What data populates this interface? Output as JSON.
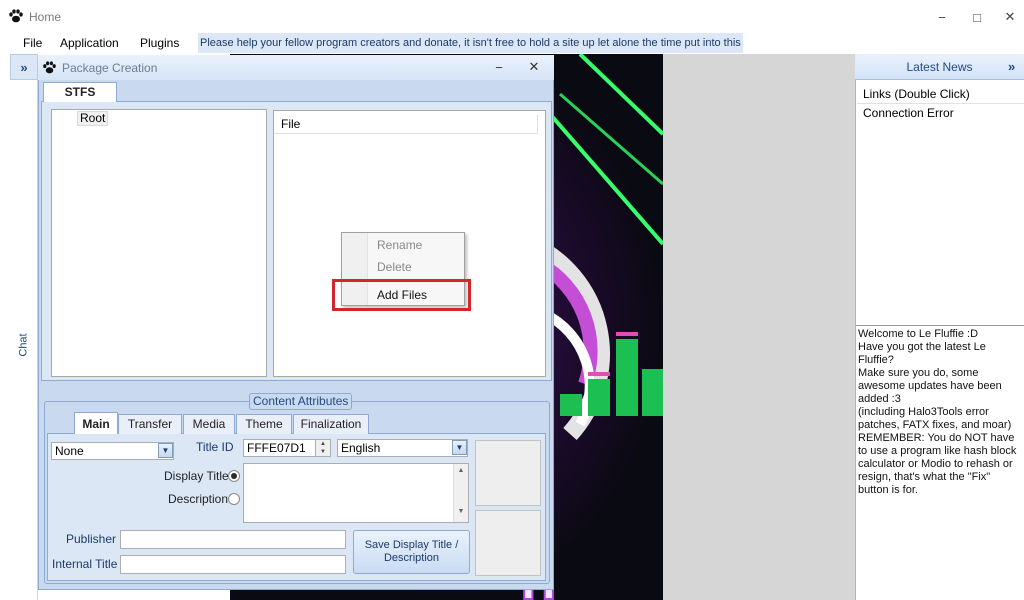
{
  "window": {
    "title": "Home",
    "minimize_glyph": "−",
    "maximize_glyph": "□",
    "close_glyph": "✕"
  },
  "menu": {
    "items": [
      "File",
      "Application",
      "Plugins"
    ],
    "donate_text": "Please help your fellow program creators and donate, it isn't free to hold a site up let alone the time put into this"
  },
  "chat": {
    "expand_glyph": "»",
    "label": "Chat"
  },
  "news": {
    "header": "Latest News",
    "expand_glyph": "»",
    "links_header": "Links (Double Click)",
    "links_status": "Connection Error",
    "message": "Welcome to Le Fluffie :D\nHave you got the latest Le Fluffie?\nMake sure you do, some awesome updates have been added :3\n(including Halo3Tools error patches, FATX fixes, and moar)\nREMEMBER: You do NOT have to use a program like hash block calculator or Modio to rehash or resign, that's what the \"Fix\" button is for."
  },
  "package": {
    "title": "Package Creation",
    "minimize_glyph": "−",
    "close_glyph": "✕",
    "tab": "STFS",
    "tree_root": "Root",
    "file_column": "File",
    "context_menu": {
      "items": [
        {
          "label": "Rename",
          "enabled": false
        },
        {
          "label": "Delete",
          "enabled": false
        },
        {
          "label": "Add Files",
          "enabled": true
        }
      ]
    },
    "content_attributes": {
      "title": "Content Attributes",
      "tabs": [
        "Main",
        "Transfer",
        "Media",
        "Theme",
        "Finalization"
      ],
      "active_tab": "Main",
      "type_select": "None",
      "title_id_label": "Title ID",
      "title_id_value": "FFFE07D1",
      "language_select": "English",
      "display_title_label": "Display Title",
      "description_label": "Description",
      "display_title_selected": true,
      "publisher_label": "Publisher",
      "publisher_value": "",
      "internal_title_label": "Internal Title",
      "internal_title_value": "",
      "save_button": "Save Display Title / Description"
    }
  },
  "colors": {
    "highlight_box": "#d1272c",
    "accent_blue": "#244a85",
    "panel_blue": "#c9daf0"
  }
}
